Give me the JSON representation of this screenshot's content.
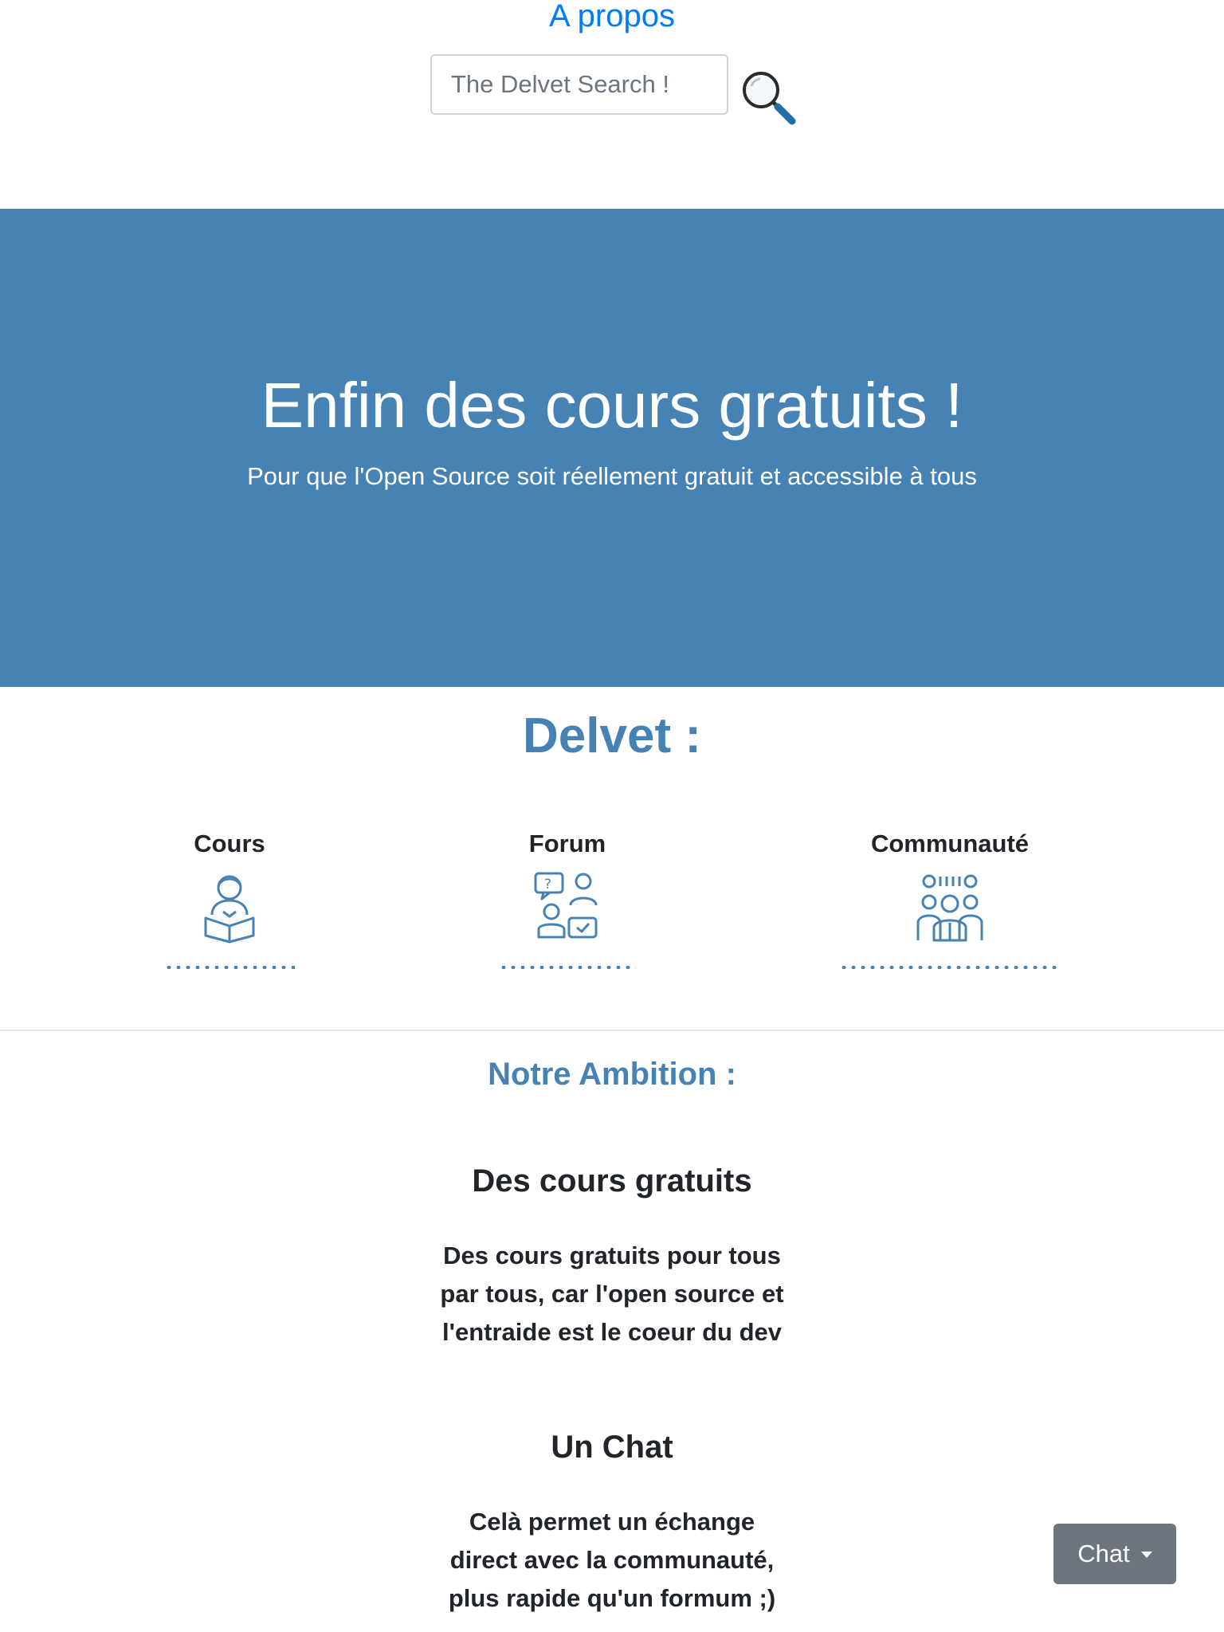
{
  "nav": {
    "about_label": "A propos"
  },
  "search": {
    "placeholder": "The Delvet Search !",
    "icon": "magnifier-icon"
  },
  "hero": {
    "title": "Enfin des cours gratuits !",
    "subtitle": "Pour que l'Open Source soit réellement gratuit et accessible à tous",
    "background": "#4682b4"
  },
  "brand": {
    "title": "Delvet :"
  },
  "features": [
    {
      "label": "Cours",
      "icon": "reader-book-icon"
    },
    {
      "label": "Forum",
      "icon": "question-discussion-icon"
    },
    {
      "label": "Communauté",
      "icon": "community-group-icon"
    }
  ],
  "ambition": {
    "title": "Notre Ambition :",
    "blocks": [
      {
        "title": "Des cours gratuits",
        "text": "Des cours gratuits pour tous par tous, car l'open source et l'entraide est le coeur du dev"
      },
      {
        "title": "Un Chat",
        "text": "Celà permet un échange direct avec la communauté, plus rapide qu'un formum ;)"
      }
    ]
  },
  "chat_button": {
    "label": "Chat"
  },
  "colors": {
    "accent": "#4682b4",
    "link": "#007bff",
    "chat_button": "#6c757d"
  }
}
